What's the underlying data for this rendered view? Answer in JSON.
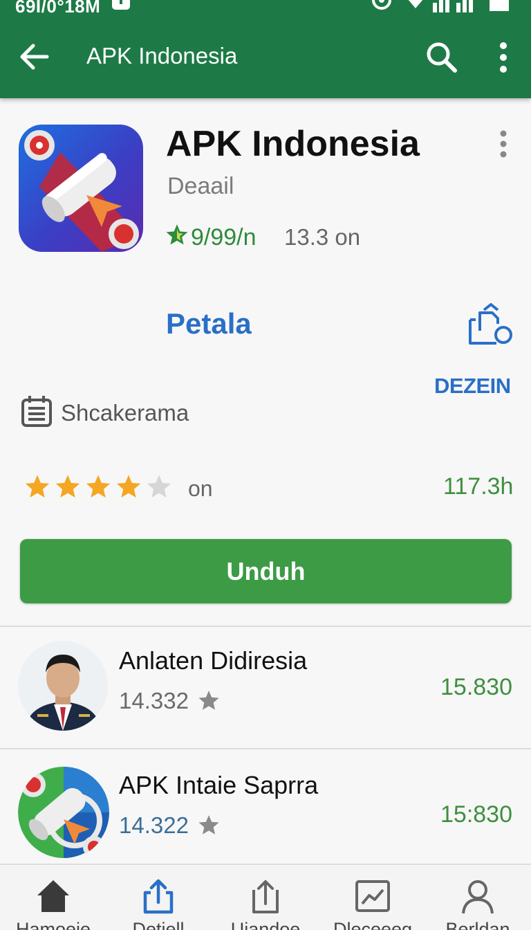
{
  "status_bar": {
    "time": "69I/0°18M"
  },
  "app_bar": {
    "title": "APK Indonesia",
    "icons": [
      "back-arrow-icon",
      "search-icon",
      "more-vert-icon"
    ],
    "color": "#1d7a46"
  },
  "header": {
    "title": "APK Indonesia",
    "subtitle": "Deaail",
    "rating": "9/99/n",
    "size": "13.3 on"
  },
  "section": {
    "heading": "Petala",
    "link": "DEZEIN",
    "meta_label": "Shcakerama"
  },
  "stars_row": {
    "rating_stars": 4,
    "max_stars": 5,
    "label": "on",
    "count": "117.3h"
  },
  "download_button": {
    "label": "Unduh",
    "color": "#3d9b46"
  },
  "list": [
    {
      "title": "Anlaten Didiresia",
      "subtitle": "14.332",
      "value": "15.830",
      "subtitle_color": "#6a6a6a"
    },
    {
      "title": "APK Intaie Saprra",
      "subtitle": "14.322",
      "value": "15:830",
      "subtitle_color": "#3a6f98"
    }
  ],
  "bottom_nav": [
    {
      "label": "Hamoeie",
      "icon": "home-icon"
    },
    {
      "label": "Detiell",
      "icon": "share-icon"
    },
    {
      "label": "Uiandoe",
      "icon": "upload-icon"
    },
    {
      "label": "Dleceeeg",
      "icon": "chart-icon"
    },
    {
      "label": "Berldan",
      "icon": "profile-icon"
    }
  ]
}
